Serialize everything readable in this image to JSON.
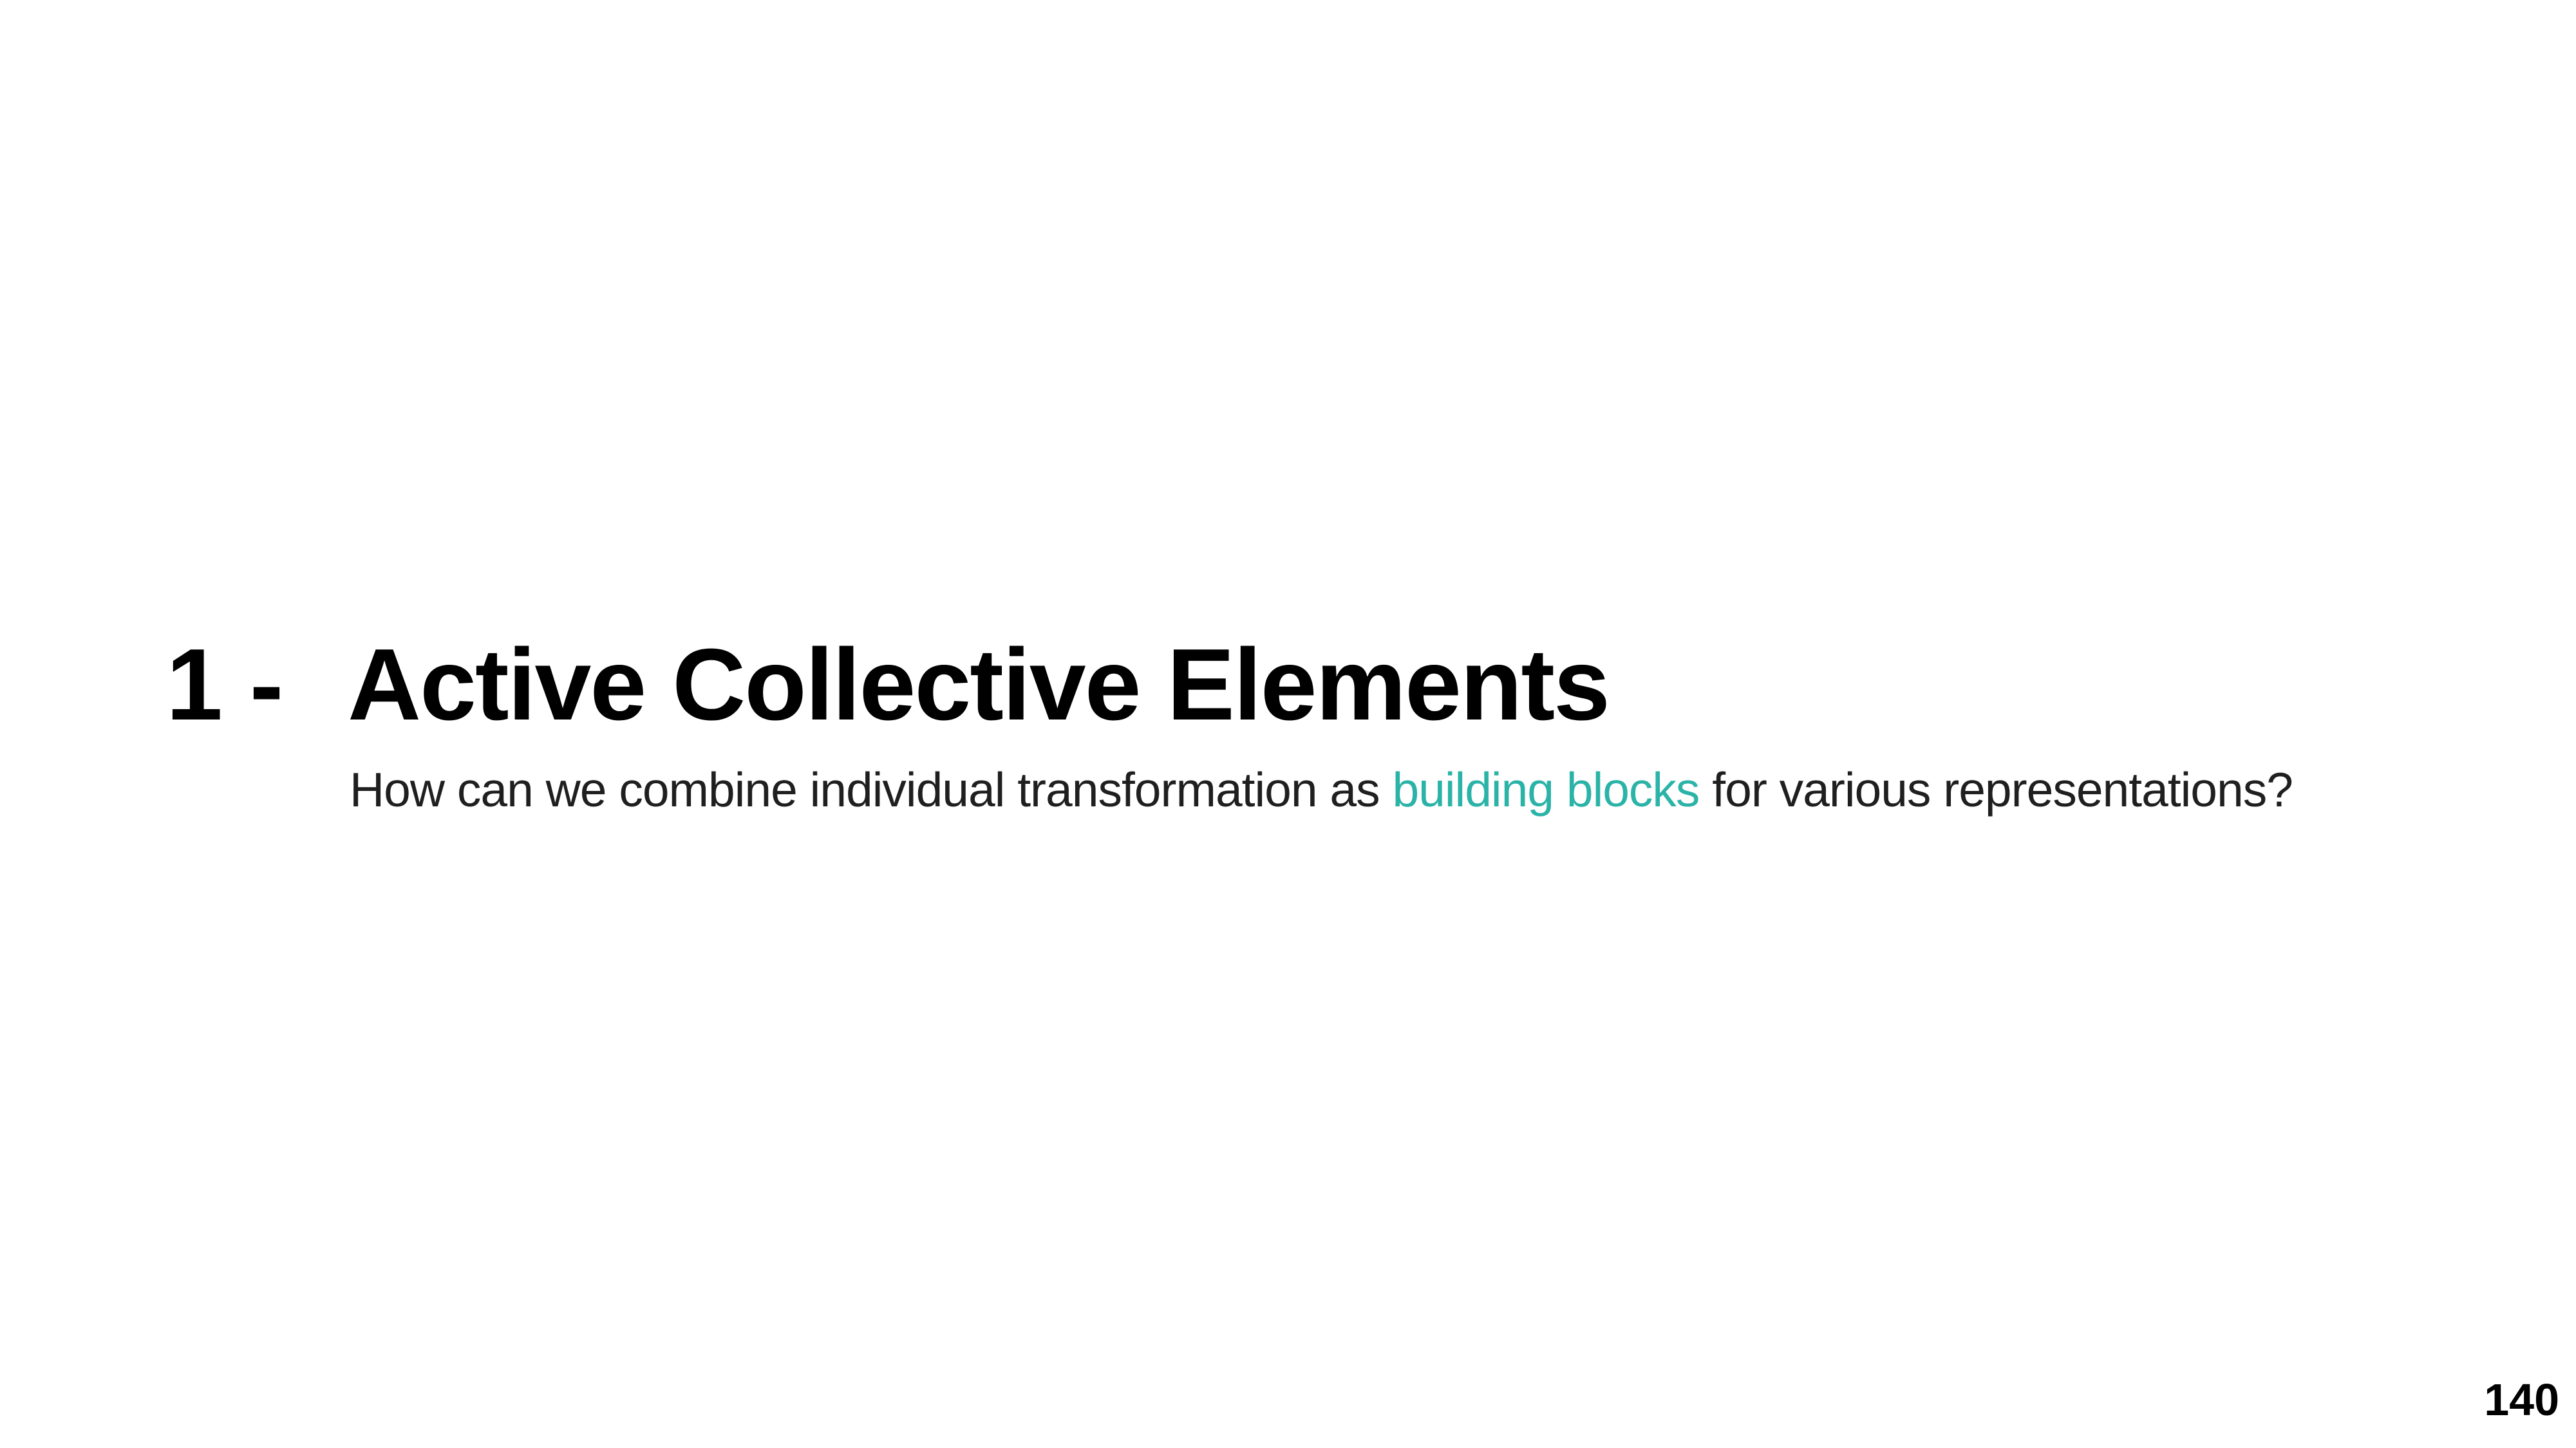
{
  "slide": {
    "section_number": "1 -",
    "section_title": "Active Collective Elements",
    "subtitle": {
      "before": "How can we combine individual transformation as ",
      "highlight": "building blocks",
      "after": " for various representations?"
    },
    "page_number": "140"
  },
  "colors": {
    "background": "#ffffff",
    "text": "#000000",
    "highlight": "#2bb3a8"
  }
}
